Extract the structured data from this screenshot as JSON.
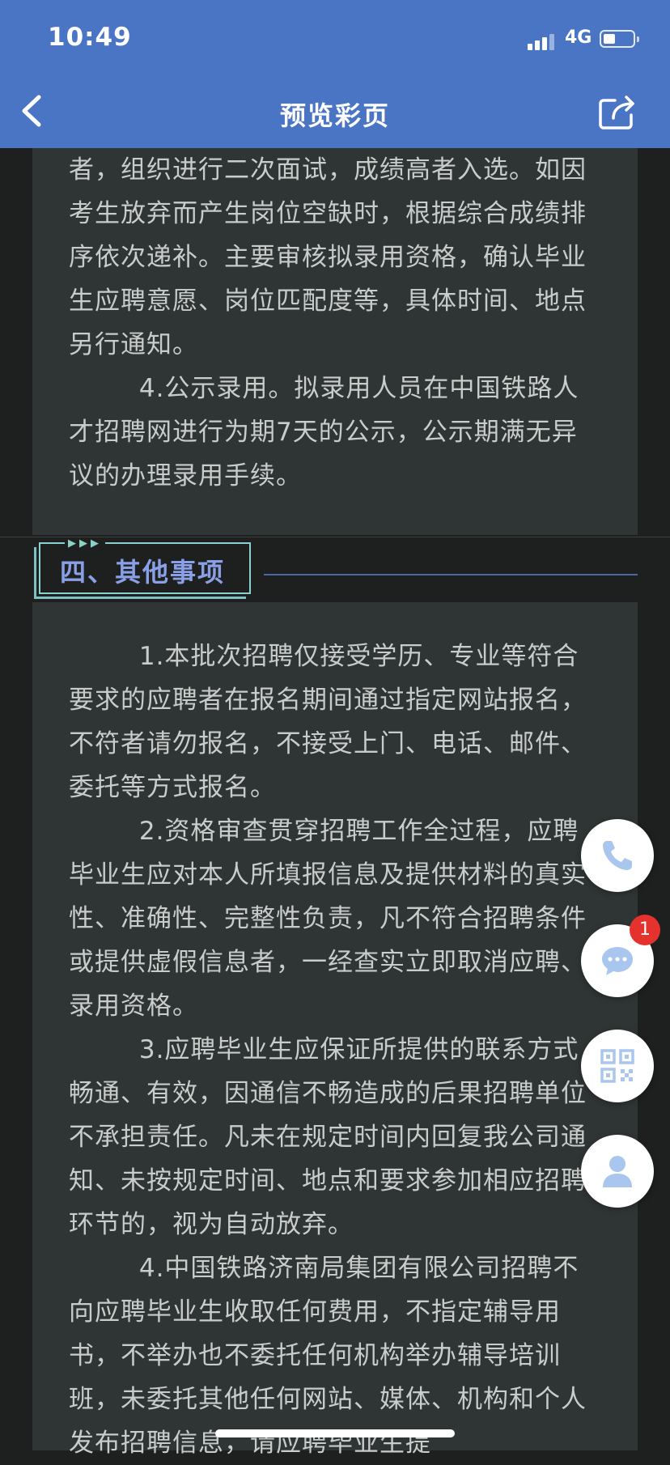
{
  "status_bar": {
    "time": "10:49",
    "network": "4G"
  },
  "nav": {
    "title": "预览彩页"
  },
  "section1": {
    "paragraphs": [
      "者，组织进行二次面试，成绩高者入选。如因考生放弃而产生岗位空缺时，根据综合成绩排序依次递补。主要审核拟录用资格，确认毕业生应聘意愿、岗位匹配度等，具体时间、地点另行通知。",
      "        4.公示录用。拟录用人员在中国铁路人才招聘网进行为期7天的公示，公示期满无异议的办理录用手续。"
    ]
  },
  "section2": {
    "heading": "四、其他事项",
    "paragraphs": [
      "        1.本批次招聘仅接受学历、专业等符合要求的应聘者在报名期间通过指定网站报名，不符者请勿报名，不接受上门、电话、邮件、委托等方式报名。",
      "        2.资格审查贯穿招聘工作全过程，应聘毕业生应对本人所填报信息及提供材料的真实性、准确性、完整性负责，凡不符合招聘条件或提供虚假信息者，一经查实立即取消应聘、录用资格。",
      "        3.应聘毕业生应保证所提供的联系方式畅通、有效，因通信不畅造成的后果招聘单位不承担责任。凡未在规定时间内回复我公司通知、未按规定时间、地点和要求参加相应招聘环节的，视为自动放弃。",
      "        4.中国铁路济南局集团有限公司招聘不向应聘毕业生收取任何费用，不指定辅导用书，不举办也不委托任何机构举办辅导培训班，未委托其他任何网站、媒体、机构和个人发布招聘信息，请应聘毕业生提"
    ]
  },
  "floating": {
    "message_badge": "1"
  },
  "colors": {
    "nav_bg": "#4a74c4",
    "card_bg": "#2f3534",
    "heading": "#8aa0e6",
    "badge": "#e5322d"
  },
  "icons": [
    "back-arrow-icon",
    "share-icon",
    "phone-icon",
    "chat-icon",
    "qr-code-icon",
    "user-icon"
  ]
}
